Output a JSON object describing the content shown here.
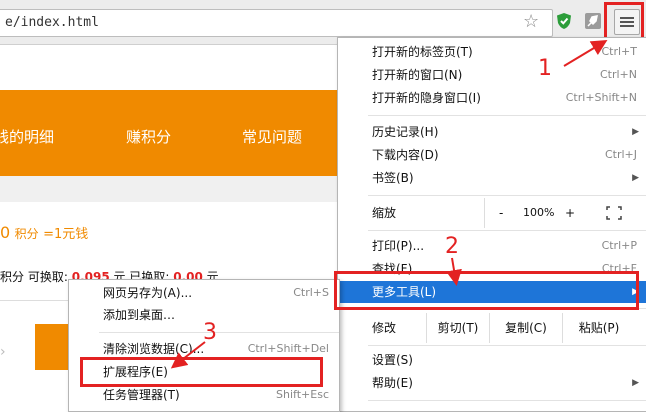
{
  "browser": {
    "url": "e/index.html",
    "star_icon": "star-icon",
    "accent": "#f08a00",
    "annotation_color": "#e32222"
  },
  "page": {
    "nav_items": [
      "钱的明细",
      "赚积分",
      "常见问题"
    ],
    "rate_prefix": "0",
    "rate_unit": "积分",
    "rate_eq": "=1元钱",
    "points_label": "积分",
    "exchange_label": "可换取:",
    "exchange_value": "0.095",
    "exchange_unit": "元",
    "redeemed_label": "已换取:",
    "redeemed_value": "0.00",
    "redeemed_unit": "元"
  },
  "main_menu": {
    "items": [
      {
        "label": "打开新的标签页(T)",
        "shortcut": "Ctrl+T"
      },
      {
        "label": "打开新的窗口(N)",
        "shortcut": "Ctrl+N"
      },
      {
        "label": "打开新的隐身窗口(I)",
        "shortcut": "Ctrl+Shift+N"
      },
      {
        "label": "历史记录(H)",
        "shortcut": ""
      },
      {
        "label": "下载内容(D)",
        "shortcut": "Ctrl+J"
      },
      {
        "label": "书签(B)",
        "shortcut": ""
      },
      {
        "label": "打印(P)...",
        "shortcut": "Ctrl+P"
      },
      {
        "label": "查找(F)...",
        "shortcut": "Ctrl+F"
      },
      {
        "label": "更多工具(L)",
        "shortcut": ""
      },
      {
        "label": "设置(S)",
        "shortcut": ""
      },
      {
        "label": "帮助(E)",
        "shortcut": ""
      }
    ],
    "zoom": {
      "label": "缩放",
      "minus": "-",
      "value": "100%",
      "plus": "+"
    },
    "edit": {
      "label": "修改",
      "cut": "剪切(T)",
      "copy": "复制(C)",
      "paste": "粘贴(P)"
    }
  },
  "sub_menu": {
    "items": [
      {
        "label": "网页另存为(A)...",
        "shortcut": "Ctrl+S"
      },
      {
        "label": "添加到桌面…",
        "shortcut": ""
      },
      {
        "label": "清除浏览数据(C)...",
        "shortcut": "Ctrl+Shift+Del"
      },
      {
        "label": "扩展程序(E)",
        "shortcut": ""
      },
      {
        "label": "任务管理器(T)",
        "shortcut": "Shift+Esc"
      }
    ]
  },
  "annotations": [
    "1",
    "2",
    "3"
  ]
}
